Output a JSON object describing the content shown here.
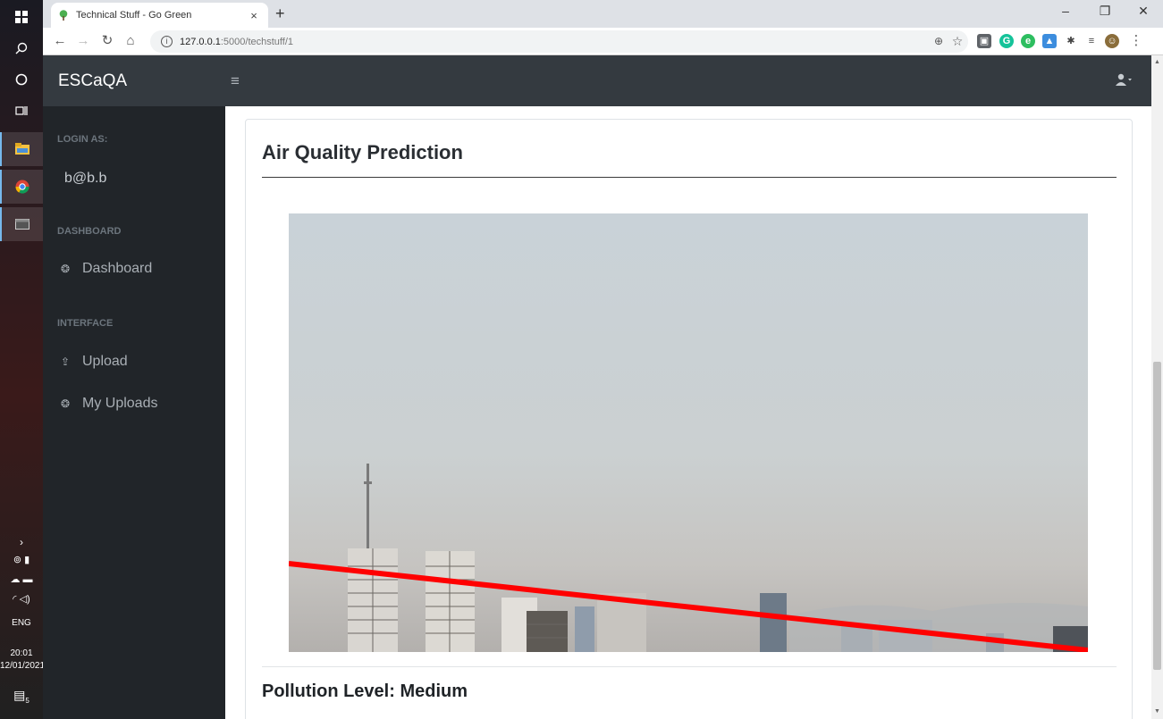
{
  "taskbar": {
    "tray": {
      "lang": "ENG",
      "time": "20:01",
      "date": "12/01/2021",
      "notifications": "5"
    }
  },
  "browser": {
    "tab": {
      "title": "Technical Stuff - Go Green",
      "close": "×"
    },
    "new_tab": "+",
    "url": {
      "host": "127.0.0.1",
      "path": ":5000/techstuff/1"
    },
    "window_controls": {
      "minimize": "–",
      "maximize": "❐",
      "close": "✕"
    }
  },
  "app": {
    "brand": "ESCaQA",
    "sidebar": {
      "login_heading": "LOGIN AS:",
      "user": "b@b.b",
      "dashboard_heading": "DASHBOARD",
      "dashboard_link": "Dashboard",
      "interface_heading": "INTERFACE",
      "upload_link": "Upload",
      "my_uploads_link": "My Uploads"
    },
    "card": {
      "title": "Air Quality Prediction",
      "result": "Pollution Level: Medium"
    }
  },
  "colors": {
    "navbar": "#343a40",
    "sidebar": "#212529",
    "overlay_line": "#ff0000"
  }
}
